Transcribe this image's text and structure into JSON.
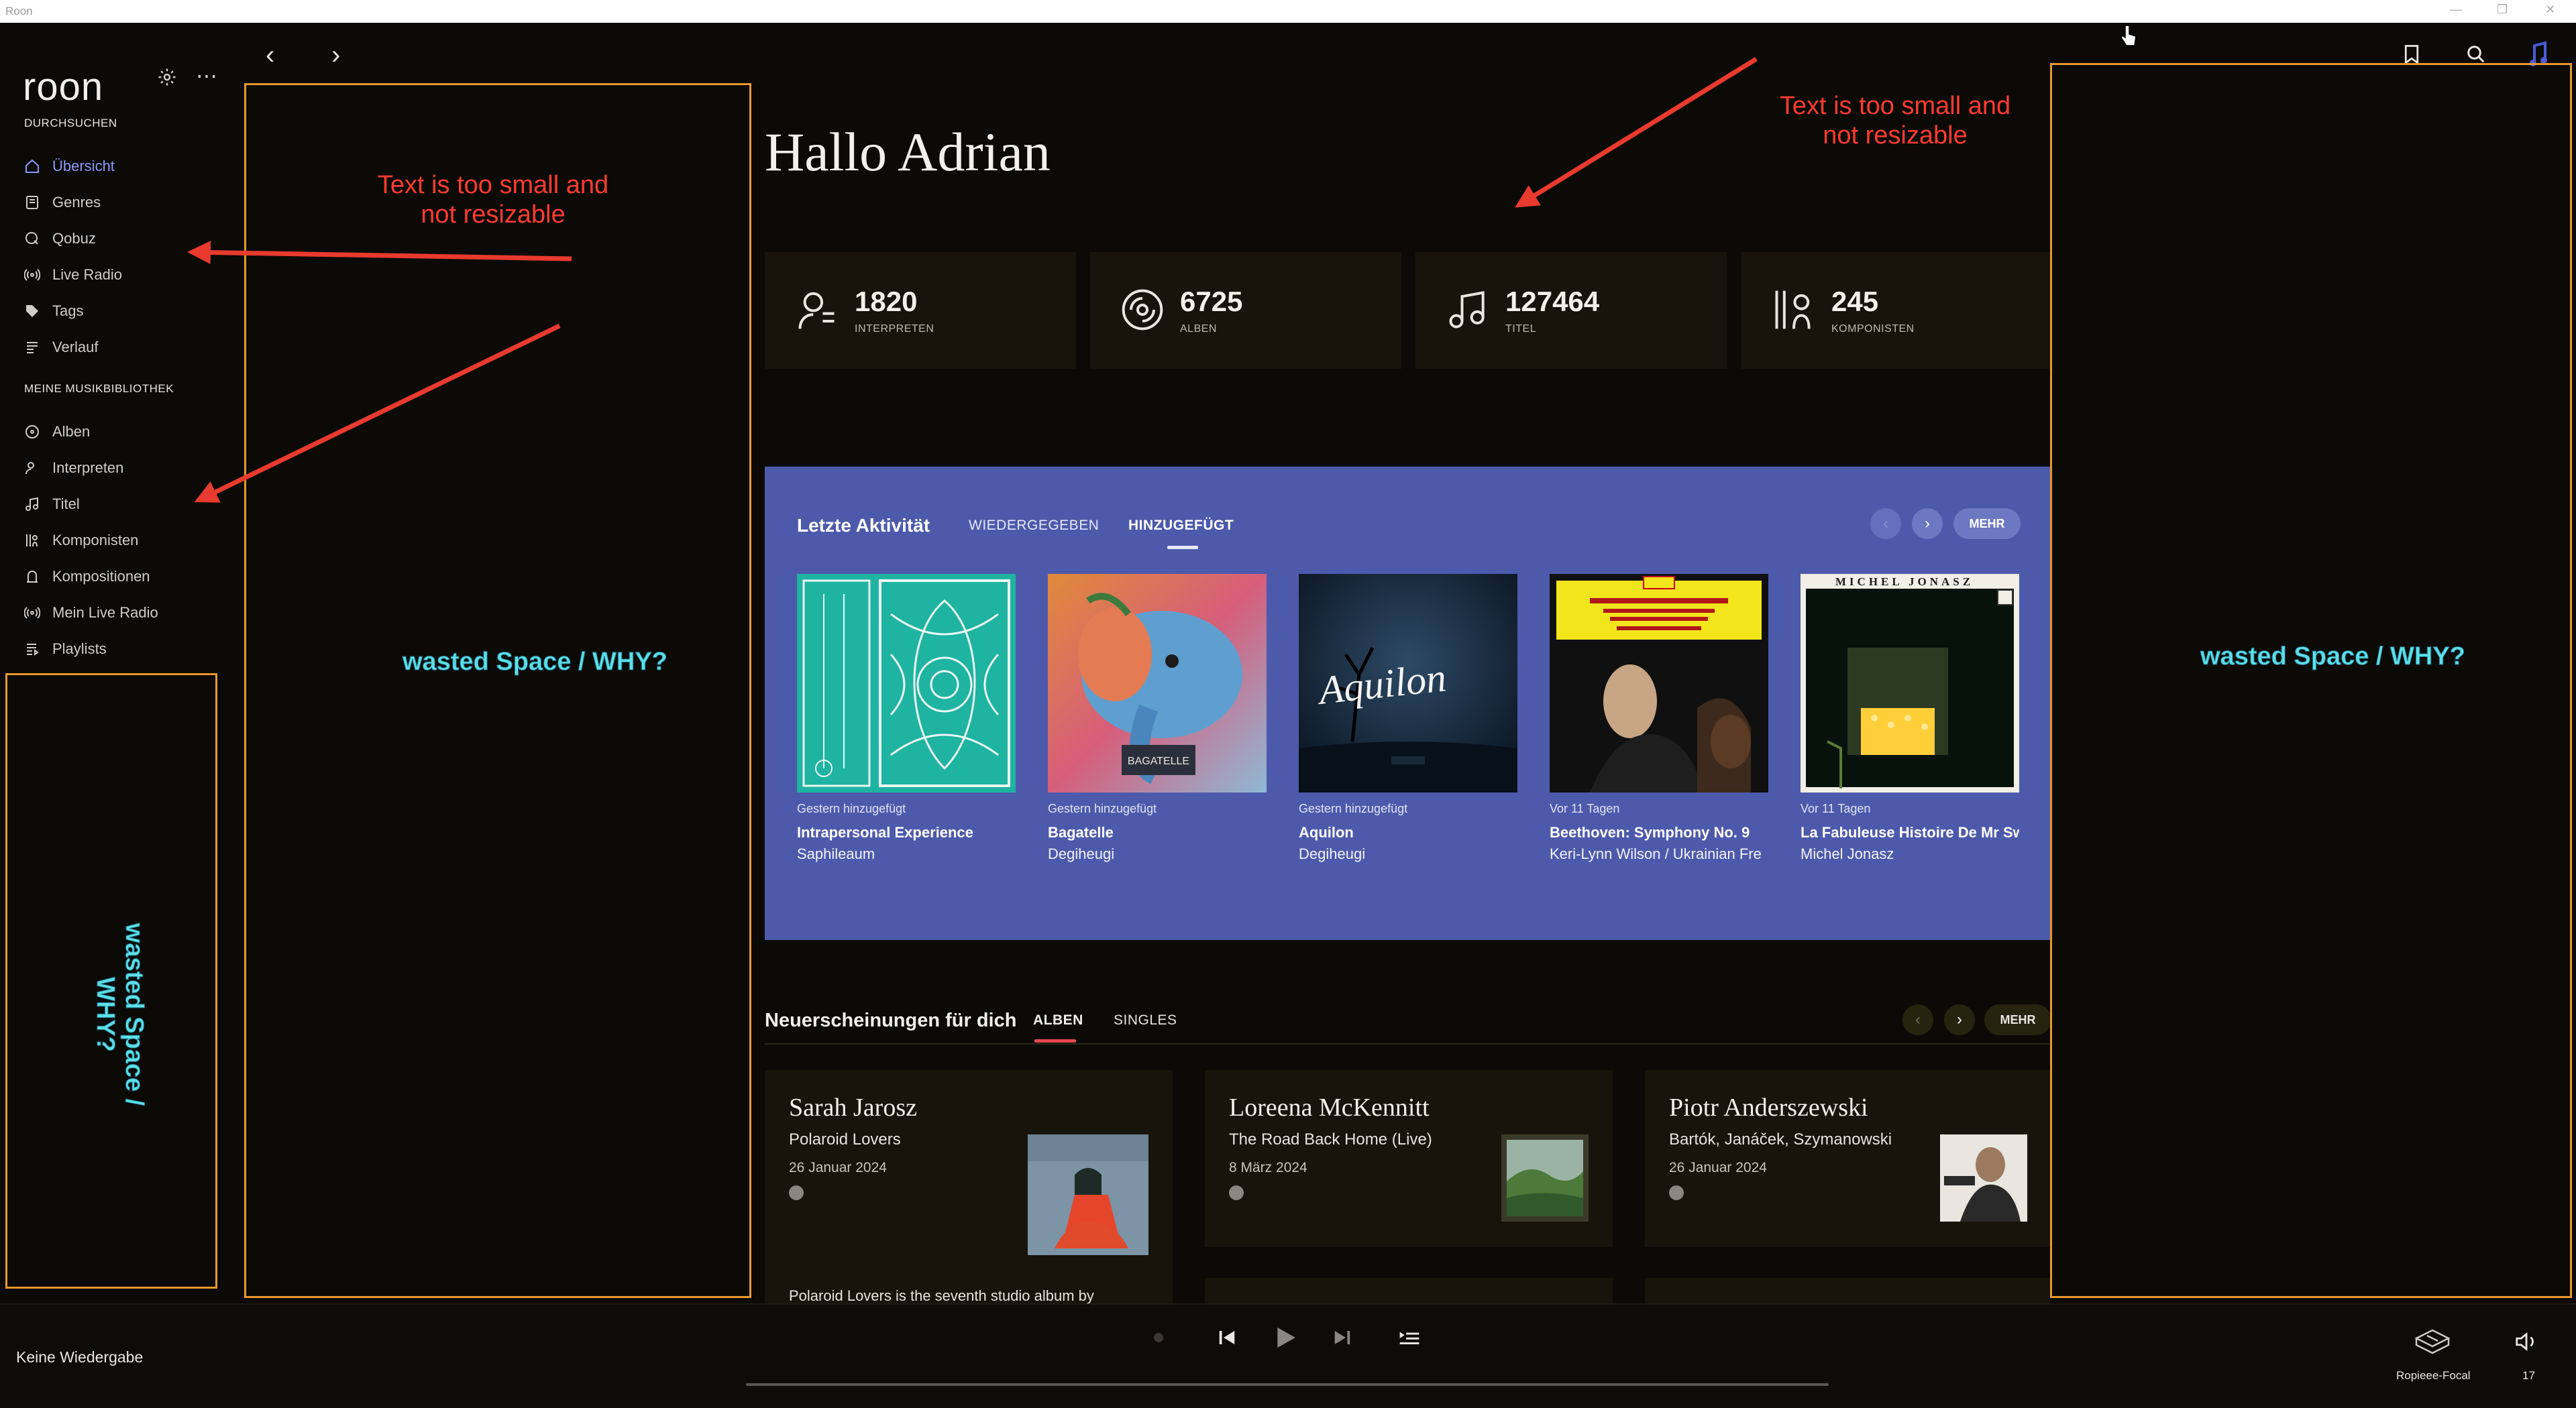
{
  "window": {
    "title": "Roon"
  },
  "sidebar": {
    "logo": "roon",
    "sections": [
      {
        "heading": "DURCHSUCHEN",
        "items": [
          {
            "label": "Übersicht",
            "icon": "home-icon",
            "active": true
          },
          {
            "label": "Genres",
            "icon": "genres-icon"
          },
          {
            "label": "Qobuz",
            "icon": "qobuz-icon"
          },
          {
            "label": "Live Radio",
            "icon": "radio-icon"
          },
          {
            "label": "Tags",
            "icon": "tag-icon"
          },
          {
            "label": "Verlauf",
            "icon": "history-icon"
          }
        ]
      },
      {
        "heading": "MEINE MUSIKBIBLIOTHEK",
        "items": [
          {
            "label": "Alben",
            "icon": "album-icon"
          },
          {
            "label": "Interpreten",
            "icon": "artist-icon"
          },
          {
            "label": "Titel",
            "icon": "note-icon"
          },
          {
            "label": "Komponisten",
            "icon": "composer-icon"
          },
          {
            "label": "Kompositionen",
            "icon": "composition-icon"
          },
          {
            "label": "Mein Live Radio",
            "icon": "radio-icon"
          },
          {
            "label": "Playlists",
            "icon": "playlist-icon"
          }
        ]
      }
    ]
  },
  "main": {
    "greeting": "Hallo Adrian",
    "stats": [
      {
        "value": "1820",
        "label": "INTERPRETEN",
        "icon": "artist-icon"
      },
      {
        "value": "6725",
        "label": "ALBEN",
        "icon": "album-icon"
      },
      {
        "value": "127464",
        "label": "TITEL",
        "icon": "note-icon"
      },
      {
        "value": "245",
        "label": "KOMPONISTEN",
        "icon": "composer-icon"
      }
    ],
    "activity": {
      "title": "Letzte Aktivität",
      "tabs": [
        "WIEDERGEGEBEN",
        "HINZUGEFÜGT"
      ],
      "selected_tab": "HINZUGEFÜGT",
      "more": "MEHR",
      "accent": "#4d5aab",
      "items": [
        {
          "when": "Gestern hinzugefügt",
          "title": "Intrapersonal Experience",
          "artist": "Saphileaum"
        },
        {
          "when": "Gestern hinzugefügt",
          "title": "Bagatelle",
          "artist": "Degiheugi"
        },
        {
          "when": "Gestern hinzugefügt",
          "title": "Aquilon",
          "artist": "Degiheugi",
          "cover_text": "Aquilon"
        },
        {
          "when": "Vor 11 Tagen",
          "title": "Beethoven: Symphony No. 9",
          "artist": "Keri-Lynn Wilson / Ukrainian Fre"
        },
        {
          "when": "Vor 11 Tagen",
          "title": "La Fabuleuse Histoire De Mr Swi",
          "artist": "Michel Jonasz",
          "cover_text": "MICHEL JONASZ"
        }
      ]
    },
    "new_releases": {
      "title": "Neuerscheinungen für dich",
      "tabs": [
        "ALBEN",
        "SINGLES"
      ],
      "selected_tab": "ALBEN",
      "more": "MEHR",
      "items": [
        {
          "artist": "Sarah Jarosz",
          "album": "Polaroid Lovers",
          "date": "26 Januar 2024"
        },
        {
          "artist": "Loreena McKennitt",
          "album": "The Road Back Home (Live)",
          "date": "8 März 2024"
        },
        {
          "artist": "Piotr Anderszewski",
          "album": "Bartók, Janáček, Szymanowski",
          "date": "26 Januar 2024"
        }
      ],
      "review_snippet": "Polaroid Lovers is the seventh studio album by"
    }
  },
  "player": {
    "status": "Keine Wiedergabe",
    "zone": "Ropieee-Focal",
    "volume": "17"
  },
  "annotations": {
    "text_small_1": "Text is too small and\nnot resizable",
    "text_small_2": "Text is too small and\nnot resizable",
    "wasted_1": "wasted Space / WHY?",
    "wasted_2": "wasted Space / WHY?",
    "wasted_3": "wasted Space / WHY?"
  }
}
